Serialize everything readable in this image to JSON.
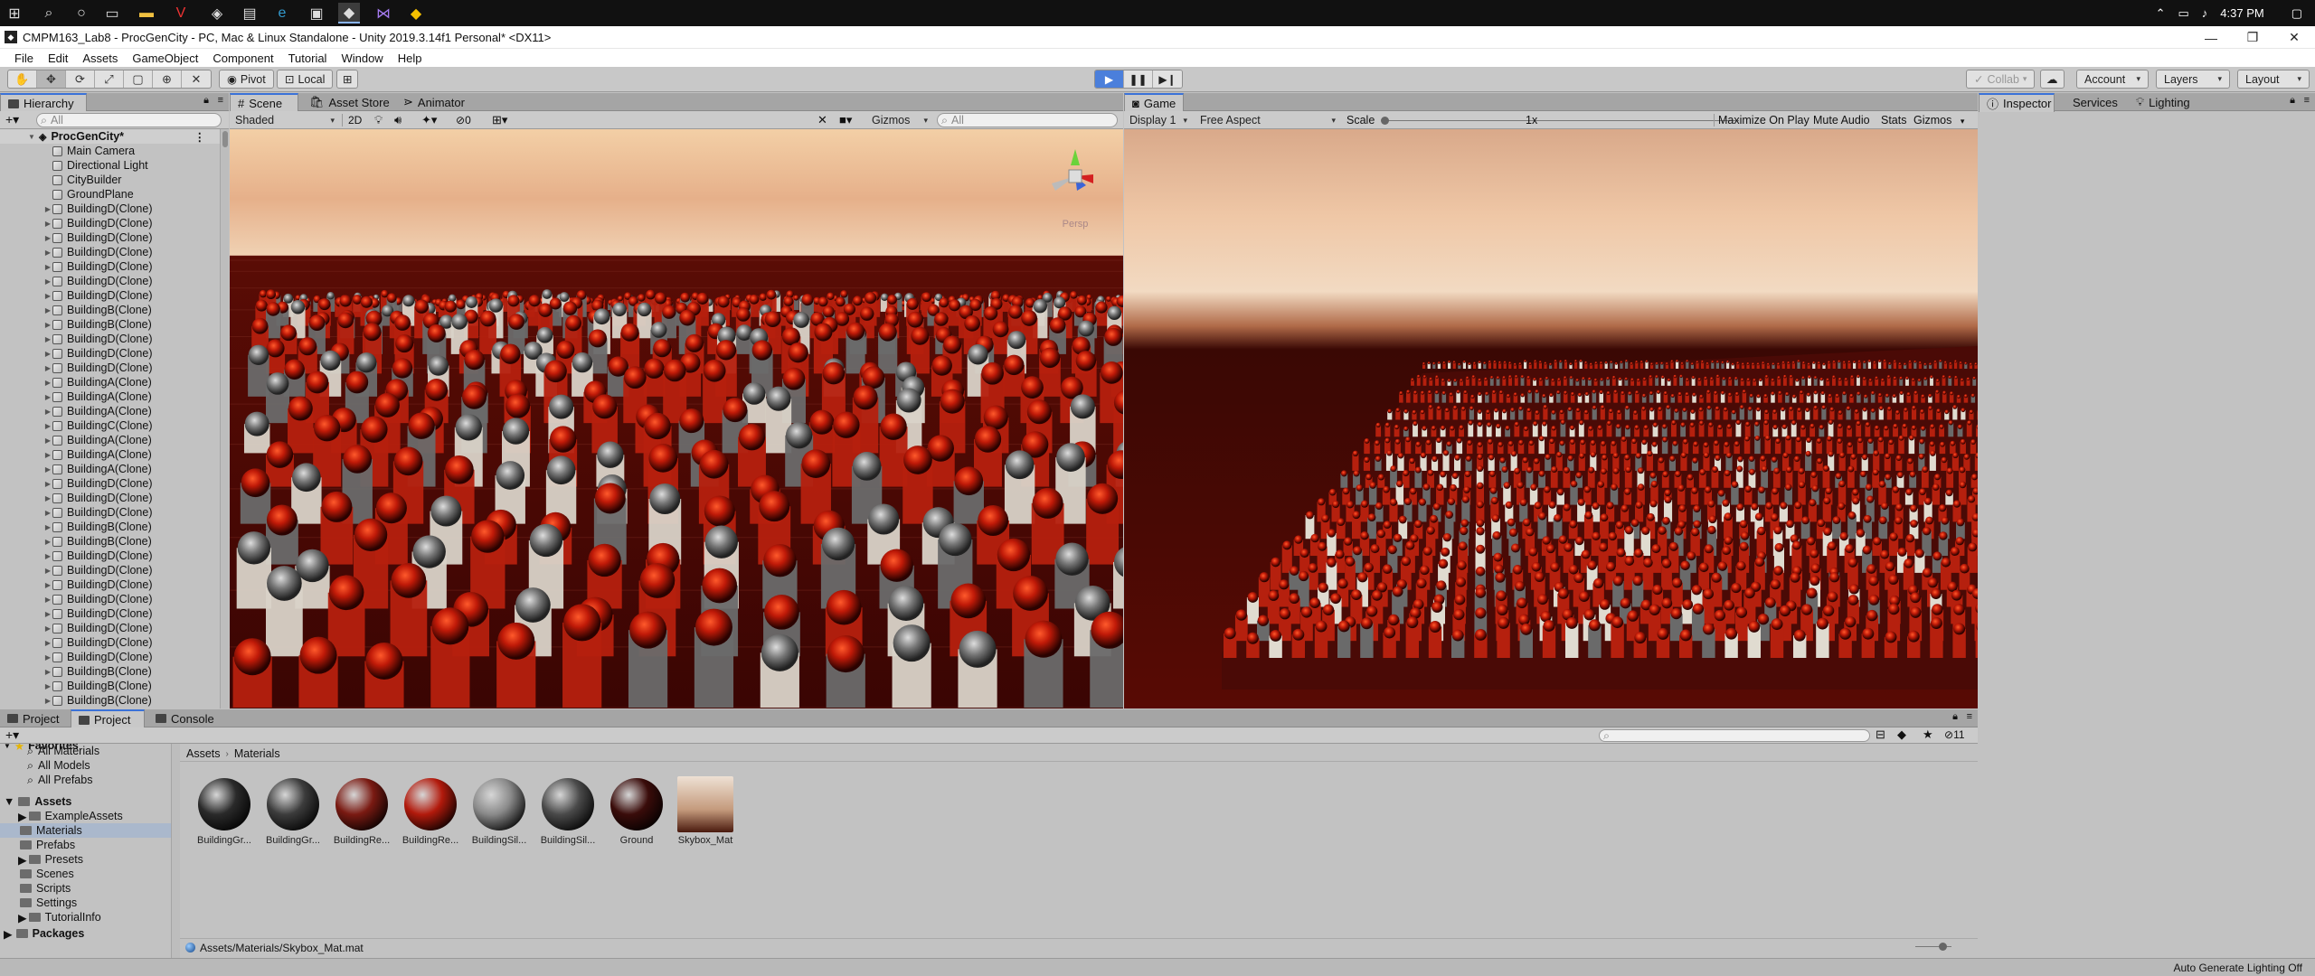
{
  "taskbar": {
    "clock": "4:37 PM",
    "tray_icons": [
      "chevron-up-icon",
      "network-icon",
      "volume-icon",
      "notification-icon"
    ]
  },
  "window": {
    "title": "CMPM163_Lab8 - ProcGenCity - PC, Mac & Linux Standalone - Unity 2019.3.14f1 Personal* <DX11>"
  },
  "menu": [
    "File",
    "Edit",
    "Assets",
    "GameObject",
    "Component",
    "Tutorial",
    "Window",
    "Help"
  ],
  "toolbar": {
    "pivot": "Pivot",
    "local": "Local",
    "collab": "Collab",
    "account": "Account",
    "layers": "Layers",
    "layout": "Layout"
  },
  "hierarchy": {
    "tab": "Hierarchy",
    "search_placeholder": "All",
    "scene": "ProcGenCity*",
    "items": [
      "Main Camera",
      "Directional Light",
      "CityBuilder",
      "GroundPlane",
      "BuildingD(Clone)",
      "BuildingD(Clone)",
      "BuildingD(Clone)",
      "BuildingD(Clone)",
      "BuildingD(Clone)",
      "BuildingD(Clone)",
      "BuildingD(Clone)",
      "BuildingB(Clone)",
      "BuildingB(Clone)",
      "BuildingD(Clone)",
      "BuildingD(Clone)",
      "BuildingD(Clone)",
      "BuildingA(Clone)",
      "BuildingA(Clone)",
      "BuildingA(Clone)",
      "BuildingC(Clone)",
      "BuildingA(Clone)",
      "BuildingA(Clone)",
      "BuildingA(Clone)",
      "BuildingD(Clone)",
      "BuildingD(Clone)",
      "BuildingD(Clone)",
      "BuildingB(Clone)",
      "BuildingB(Clone)",
      "BuildingD(Clone)",
      "BuildingD(Clone)",
      "BuildingD(Clone)",
      "BuildingD(Clone)",
      "BuildingD(Clone)",
      "BuildingD(Clone)",
      "BuildingD(Clone)",
      "BuildingD(Clone)",
      "BuildingB(Clone)",
      "BuildingB(Clone)",
      "BuildingB(Clone)",
      "BuildingB(Clone)"
    ]
  },
  "scene_view": {
    "tabs": [
      "Scene",
      "Asset Store",
      "Animator"
    ],
    "shading": "Shaded",
    "mode_2d": "2D",
    "fx_count": "0",
    "gizmos": "Gizmos",
    "search_placeholder": "All",
    "persp_label": "Persp",
    "axis_labels": {
      "y": "y",
      "x": "x",
      "z": "z"
    }
  },
  "game_view": {
    "tab": "Game",
    "display": "Display 1",
    "aspect": "Free Aspect",
    "scale_label": "Scale",
    "scale_value": "1x",
    "maximize": "Maximize On Play",
    "mute": "Mute Audio",
    "stats": "Stats",
    "gizmos": "Gizmos"
  },
  "inspector": {
    "tabs": [
      "Inspector",
      "Services",
      "Lighting"
    ]
  },
  "bottom": {
    "tabs": [
      "Project",
      "Project",
      "Console"
    ],
    "favorites_label": "Favorites",
    "favorites": [
      "All Materials",
      "All Models",
      "All Prefabs"
    ],
    "assets_label": "Assets",
    "asset_folders": [
      "ExampleAssets",
      "Materials",
      "Prefabs",
      "Presets",
      "Scenes",
      "Scripts",
      "Settings",
      "TutorialInfo"
    ],
    "packages_label": "Packages",
    "breadcrumb": [
      "Assets",
      "Materials"
    ],
    "hidden_count": "11",
    "materials": [
      {
        "label": "BuildingGr...",
        "color": "#2a2a2a"
      },
      {
        "label": "BuildingGr...",
        "color": "#3c3c3c"
      },
      {
        "label": "BuildingRe...",
        "color": "#7a1a12"
      },
      {
        "label": "BuildingRe...",
        "color": "#b21a0c"
      },
      {
        "label": "BuildingSil...",
        "color": "#8a8a8a"
      },
      {
        "label": "BuildingSil...",
        "color": "#4a4a4a"
      },
      {
        "label": "Ground",
        "color": "#3a0c0a"
      },
      {
        "label": "Skybox_Mat",
        "color": "#c9a88c"
      }
    ],
    "selected_path": "Assets/Materials/Skybox_Mat.mat"
  },
  "status": {
    "right_text": "Auto Generate Lighting Off"
  },
  "colors": {
    "accent": "#3a72d8",
    "play_active": "#4b7fdb",
    "ground_red": "#5a0b04",
    "building_red": "#c2230f"
  }
}
